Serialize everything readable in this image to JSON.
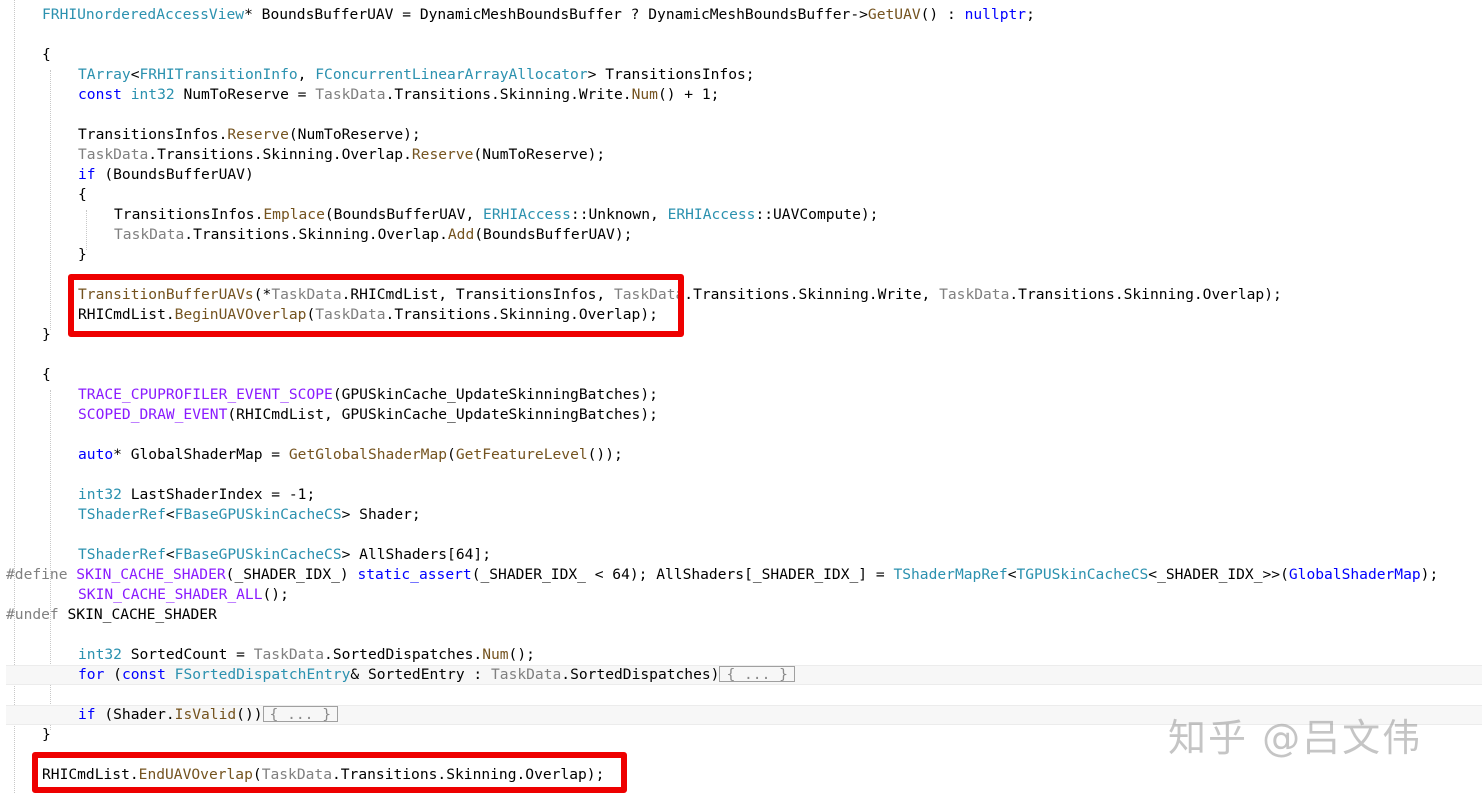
{
  "colors": {
    "type": "#2b91af",
    "keyword": "#0000ff",
    "function": "#74531f",
    "param": "#808080",
    "macro": "#8a1bff",
    "text": "#000000",
    "highlight_box": "#ee0000"
  },
  "code_lines": [
    {
      "indent": 1,
      "tokens": [
        {
          "t": "FRHIUnorderedAccessView",
          "c": "type"
        },
        {
          "t": "* BoundsBufferUAV = DynamicMeshBoundsBuffer ? DynamicMeshBoundsBuffer->",
          "c": "text"
        },
        {
          "t": "GetUAV",
          "c": "function"
        },
        {
          "t": "() : ",
          "c": "text"
        },
        {
          "t": "nullptr",
          "c": "keyword"
        },
        {
          "t": ";",
          "c": "text"
        }
      ]
    },
    {
      "indent": 0,
      "tokens": []
    },
    {
      "indent": 1,
      "tokens": [
        {
          "t": "{",
          "c": "text"
        }
      ]
    },
    {
      "indent": 2,
      "tokens": [
        {
          "t": "TArray",
          "c": "type"
        },
        {
          "t": "<",
          "c": "text"
        },
        {
          "t": "FRHITransitionInfo",
          "c": "type"
        },
        {
          "t": ", ",
          "c": "text"
        },
        {
          "t": "FConcurrentLinearArrayAllocator",
          "c": "type"
        },
        {
          "t": "> TransitionsInfos;",
          "c": "text"
        }
      ]
    },
    {
      "indent": 2,
      "tokens": [
        {
          "t": "const",
          "c": "keyword"
        },
        {
          "t": " ",
          "c": "text"
        },
        {
          "t": "int32",
          "c": "type"
        },
        {
          "t": " NumToReserve = ",
          "c": "text"
        },
        {
          "t": "TaskData",
          "c": "param"
        },
        {
          "t": ".Transitions.Skinning.Write.",
          "c": "text"
        },
        {
          "t": "Num",
          "c": "function"
        },
        {
          "t": "() + 1;",
          "c": "text"
        }
      ]
    },
    {
      "indent": 0,
      "tokens": []
    },
    {
      "indent": 2,
      "tokens": [
        {
          "t": "TransitionsInfos.",
          "c": "text"
        },
        {
          "t": "Reserve",
          "c": "function"
        },
        {
          "t": "(NumToReserve);",
          "c": "text"
        }
      ]
    },
    {
      "indent": 2,
      "tokens": [
        {
          "t": "TaskData",
          "c": "param"
        },
        {
          "t": ".Transitions.Skinning.Overlap.",
          "c": "text"
        },
        {
          "t": "Reserve",
          "c": "function"
        },
        {
          "t": "(NumToReserve);",
          "c": "text"
        }
      ]
    },
    {
      "indent": 2,
      "tokens": [
        {
          "t": "if",
          "c": "keyword"
        },
        {
          "t": " (BoundsBufferUAV)",
          "c": "text"
        }
      ]
    },
    {
      "indent": 2,
      "tokens": [
        {
          "t": "{",
          "c": "text"
        }
      ]
    },
    {
      "indent": 3,
      "tokens": [
        {
          "t": "TransitionsInfos.",
          "c": "text"
        },
        {
          "t": "Emplace",
          "c": "function"
        },
        {
          "t": "(BoundsBufferUAV, ",
          "c": "text"
        },
        {
          "t": "ERHIAccess",
          "c": "type"
        },
        {
          "t": "::Unknown, ",
          "c": "text"
        },
        {
          "t": "ERHIAccess",
          "c": "type"
        },
        {
          "t": "::UAVCompute);",
          "c": "text"
        }
      ]
    },
    {
      "indent": 3,
      "tokens": [
        {
          "t": "TaskData",
          "c": "param"
        },
        {
          "t": ".Transitions.Skinning.Overlap.",
          "c": "text"
        },
        {
          "t": "Add",
          "c": "function"
        },
        {
          "t": "(BoundsBufferUAV);",
          "c": "text"
        }
      ]
    },
    {
      "indent": 2,
      "tokens": [
        {
          "t": "}",
          "c": "text"
        }
      ]
    },
    {
      "indent": 0,
      "tokens": []
    },
    {
      "indent": 2,
      "tokens": [
        {
          "t": "TransitionBufferUAVs",
          "c": "function"
        },
        {
          "t": "(*",
          "c": "text"
        },
        {
          "t": "TaskData",
          "c": "param"
        },
        {
          "t": ".RHICmdList, TransitionsInfos, ",
          "c": "text"
        },
        {
          "t": "TaskData",
          "c": "param"
        },
        {
          "t": ".Transitions.Skinning.Write, ",
          "c": "text"
        },
        {
          "t": "TaskData",
          "c": "param"
        },
        {
          "t": ".Transitions.Skinning.Overlap);",
          "c": "text"
        }
      ]
    },
    {
      "indent": 2,
      "tokens": [
        {
          "t": "RHICmdList.",
          "c": "text"
        },
        {
          "t": "BeginUAVOverlap",
          "c": "function"
        },
        {
          "t": "(",
          "c": "text"
        },
        {
          "t": "TaskData",
          "c": "param"
        },
        {
          "t": ".Transitions.Skinning.Overlap);",
          "c": "text"
        }
      ]
    },
    {
      "indent": 1,
      "tokens": [
        {
          "t": "}",
          "c": "text"
        }
      ]
    },
    {
      "indent": 0,
      "tokens": []
    },
    {
      "indent": 1,
      "tokens": [
        {
          "t": "{",
          "c": "text"
        }
      ]
    },
    {
      "indent": 2,
      "tokens": [
        {
          "t": "TRACE_CPUPROFILER_EVENT_SCOPE",
          "c": "macro"
        },
        {
          "t": "(GPUSkinCache_UpdateSkinningBatches);",
          "c": "text"
        }
      ]
    },
    {
      "indent": 2,
      "tokens": [
        {
          "t": "SCOPED_DRAW_EVENT",
          "c": "macro"
        },
        {
          "t": "(RHICmdList, GPUSkinCache_UpdateSkinningBatches);",
          "c": "text"
        }
      ]
    },
    {
      "indent": 0,
      "tokens": []
    },
    {
      "indent": 2,
      "tokens": [
        {
          "t": "auto",
          "c": "keyword"
        },
        {
          "t": "* GlobalShaderMap = ",
          "c": "text"
        },
        {
          "t": "GetGlobalShaderMap",
          "c": "function"
        },
        {
          "t": "(",
          "c": "text"
        },
        {
          "t": "GetFeatureLevel",
          "c": "function"
        },
        {
          "t": "());",
          "c": "text"
        }
      ]
    },
    {
      "indent": 0,
      "tokens": []
    },
    {
      "indent": 2,
      "tokens": [
        {
          "t": "int32",
          "c": "type"
        },
        {
          "t": " LastShaderIndex = -1;",
          "c": "text"
        }
      ]
    },
    {
      "indent": 2,
      "tokens": [
        {
          "t": "TShaderRef",
          "c": "type"
        },
        {
          "t": "<",
          "c": "text"
        },
        {
          "t": "FBaseGPUSkinCacheCS",
          "c": "type"
        },
        {
          "t": "> Shader;",
          "c": "text"
        }
      ]
    },
    {
      "indent": 0,
      "tokens": []
    },
    {
      "indent": 2,
      "tokens": [
        {
          "t": "TShaderRef",
          "c": "type"
        },
        {
          "t": "<",
          "c": "text"
        },
        {
          "t": "FBaseGPUSkinCacheCS",
          "c": "type"
        },
        {
          "t": "> AllShaders[64];",
          "c": "text"
        }
      ]
    },
    {
      "indent": 0,
      "tokens": [
        {
          "t": "#define ",
          "c": "param"
        },
        {
          "t": "SKIN_CACHE_SHADER",
          "c": "macro"
        },
        {
          "t": "(_SHADER_IDX_) ",
          "c": "text"
        },
        {
          "t": "static_assert",
          "c": "keyword"
        },
        {
          "t": "(_SHADER_IDX_ < 64); AllShaders[_SHADER_IDX_] = ",
          "c": "text"
        },
        {
          "t": "TShaderMapRef",
          "c": "type"
        },
        {
          "t": "<",
          "c": "text"
        },
        {
          "t": "TGPUSkinCacheCS",
          "c": "type"
        },
        {
          "t": "<_SHADER_IDX_>>(",
          "c": "text"
        },
        {
          "t": "GlobalShaderMap",
          "c": "keyword"
        },
        {
          "t": ");",
          "c": "text"
        }
      ]
    },
    {
      "indent": 2,
      "tokens": [
        {
          "t": "SKIN_CACHE_SHADER_ALL",
          "c": "macro"
        },
        {
          "t": "();",
          "c": "text"
        }
      ]
    },
    {
      "indent": 0,
      "tokens": [
        {
          "t": "#undef ",
          "c": "param"
        },
        {
          "t": "SKIN_CACHE_SHADER",
          "c": "text"
        }
      ]
    },
    {
      "indent": 0,
      "tokens": []
    },
    {
      "indent": 2,
      "tokens": [
        {
          "t": "int32",
          "c": "type"
        },
        {
          "t": " SortedCount = ",
          "c": "text"
        },
        {
          "t": "TaskData",
          "c": "param"
        },
        {
          "t": ".SortedDispatches.",
          "c": "text"
        },
        {
          "t": "Num",
          "c": "function"
        },
        {
          "t": "();",
          "c": "text"
        }
      ]
    },
    {
      "indent": 2,
      "current": true,
      "fold": "{ ... }",
      "tokens": [
        {
          "t": "for",
          "c": "keyword"
        },
        {
          "t": " (",
          "c": "text"
        },
        {
          "t": "const",
          "c": "keyword"
        },
        {
          "t": " ",
          "c": "text"
        },
        {
          "t": "FSortedDispatchEntry",
          "c": "type"
        },
        {
          "t": "& SortedEntry : ",
          "c": "text"
        },
        {
          "t": "TaskData",
          "c": "param"
        },
        {
          "t": ".SortedDispatches)",
          "c": "text"
        }
      ]
    },
    {
      "indent": 0,
      "tokens": []
    },
    {
      "indent": 2,
      "current": true,
      "fold": "{ ... }",
      "tokens": [
        {
          "t": "if",
          "c": "keyword"
        },
        {
          "t": " (Shader.",
          "c": "text"
        },
        {
          "t": "IsValid",
          "c": "function"
        },
        {
          "t": "())",
          "c": "text"
        }
      ]
    },
    {
      "indent": 1,
      "tokens": [
        {
          "t": "}",
          "c": "text"
        }
      ]
    },
    {
      "indent": 0,
      "tokens": []
    },
    {
      "indent": 1,
      "tokens": [
        {
          "t": "RHICmdList.",
          "c": "text"
        },
        {
          "t": "EndUAVOverlap",
          "c": "function"
        },
        {
          "t": "(",
          "c": "text"
        },
        {
          "t": "TaskData",
          "c": "param"
        },
        {
          "t": ".Transitions.Skinning.Overlap);",
          "c": "text"
        }
      ]
    }
  ],
  "watermark": "知乎 @吕文伟"
}
